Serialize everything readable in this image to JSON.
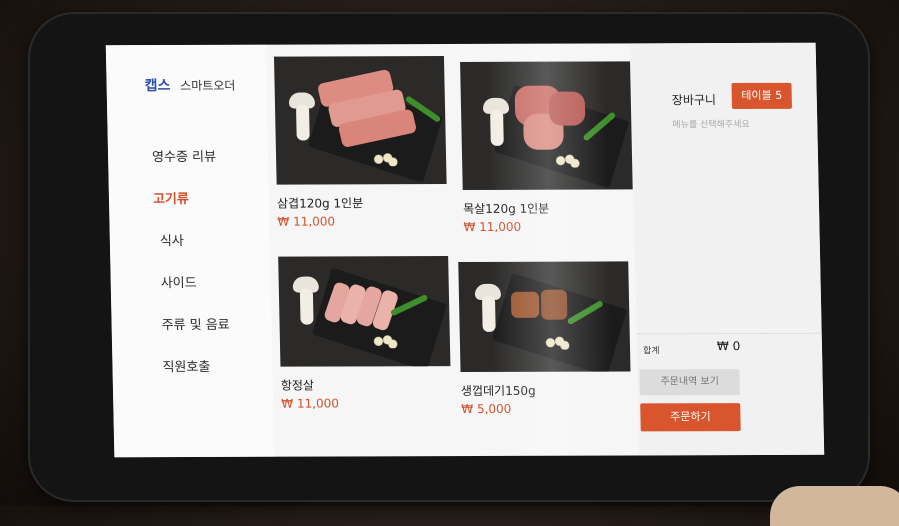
{
  "brand": {
    "logo": "캡스",
    "name": "스마트오더"
  },
  "nav": {
    "items": [
      {
        "label": "영수증 리뷰",
        "active": false
      },
      {
        "label": "고기류",
        "active": true
      },
      {
        "label": "식사",
        "active": false
      },
      {
        "label": "사이드",
        "active": false
      },
      {
        "label": "주류 및 음료",
        "active": false
      },
      {
        "label": "직원호출",
        "active": false
      }
    ]
  },
  "menu": {
    "items": [
      {
        "name": "삼겹120g 1인분",
        "price": "₩ 11,000",
        "meat_color": "#d9857a"
      },
      {
        "name": "목살120g 1인분",
        "price": "₩ 11,000",
        "meat_color": "#c96a63"
      },
      {
        "name": "항정살",
        "price": "₩ 11,000",
        "meat_color": "#e4a69e"
      },
      {
        "name": "생껍데기150g",
        "price": "₩ 5,000",
        "meat_color": "#9b5530"
      }
    ]
  },
  "cart": {
    "title": "장바구니",
    "table_badge": "테이블 5",
    "hint": "메뉴를 선택해주세요",
    "total_label": "합계",
    "total_value": "₩ 0",
    "history_button": "주문내역 보기",
    "order_button": "주문하기"
  },
  "colors": {
    "accent": "#d9552e",
    "brand": "#2a4fa8"
  }
}
